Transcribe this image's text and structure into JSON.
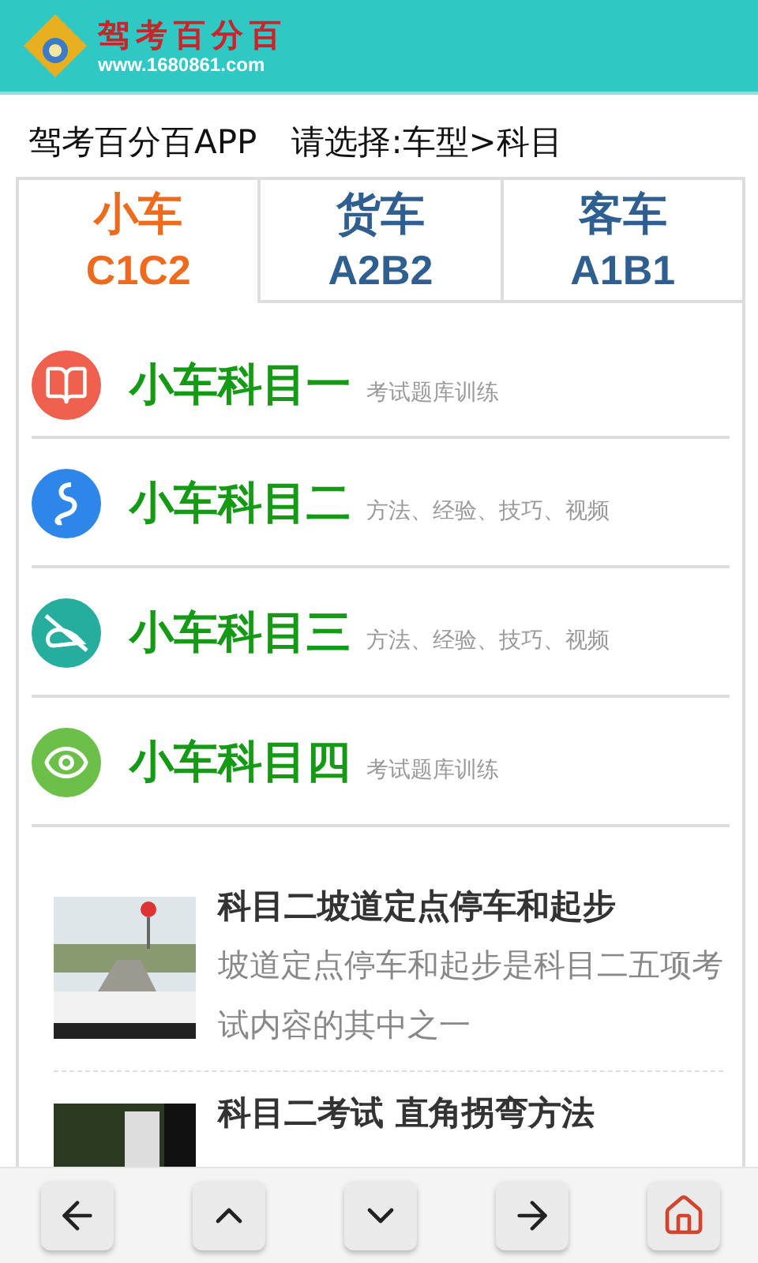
{
  "header": {
    "logo_title": "驾考百分百",
    "logo_url": "www.1680861.com"
  },
  "title_bar": {
    "app_name": "驾考百分百APP",
    "prompt": "请选择:车型>科目"
  },
  "tabs": [
    {
      "label": "小车",
      "code": "C1C2",
      "selected": true
    },
    {
      "label": "货车",
      "code": "A2B2",
      "selected": false
    },
    {
      "label": "客车",
      "code": "A1B1",
      "selected": false
    }
  ],
  "subjects": [
    {
      "kind": "book",
      "title": "小车科目一",
      "subtitle": "考试题库训练",
      "color": "#f0604e"
    },
    {
      "kind": "route",
      "title": "小车科目二",
      "subtitle": "方法、经验、技巧、视频",
      "color": "#2e86e8"
    },
    {
      "kind": "hand",
      "title": "小车科目三",
      "subtitle": "方法、经验、技巧、视频",
      "color": "#25ad9e"
    },
    {
      "kind": "eye",
      "title": "小车科目四",
      "subtitle": "考试题库训练",
      "color": "#6cc04a"
    }
  ],
  "articles": [
    {
      "title": "科目二坡道定点停车和起步",
      "summary": "坡道定点停车和起步是科目二五项考试内容的其中之一"
    },
    {
      "title": "科目二考试 直角拐弯方法"
    }
  ],
  "nav_buttons": [
    {
      "kind": "back"
    },
    {
      "kind": "up"
    },
    {
      "kind": "down"
    },
    {
      "kind": "forward"
    },
    {
      "kind": "home"
    }
  ]
}
